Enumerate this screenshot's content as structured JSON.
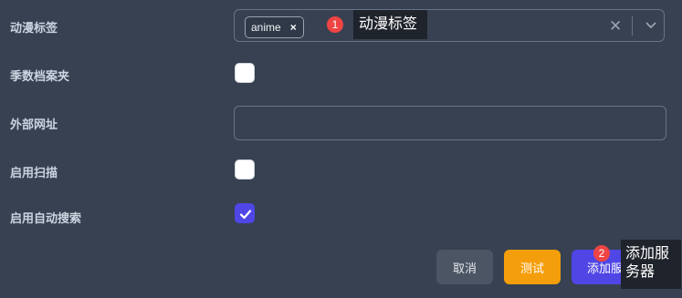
{
  "fields": {
    "anime_tags": {
      "label": "动漫标签",
      "tag": "anime",
      "tag_remove": "×"
    },
    "season_folder": {
      "label": "季数档案夹",
      "checked": false
    },
    "external_url": {
      "label": "外部网址",
      "value": ""
    },
    "enable_scan": {
      "label": "启用扫描",
      "checked": false
    },
    "enable_auto_search": {
      "label": "启用自动搜索",
      "checked": true
    }
  },
  "buttons": {
    "cancel": "取消",
    "test": "测试",
    "add": "添加服务器"
  },
  "annotations": [
    {
      "number": "1",
      "tooltip": "动漫标签"
    },
    {
      "number": "2",
      "tooltip_line1": "添加服",
      "tooltip_line2": "务器"
    }
  ],
  "colors": {
    "background": "#374151",
    "primary": "#4f46e5",
    "warning": "#f59e0b",
    "badge": "#ef4444"
  }
}
